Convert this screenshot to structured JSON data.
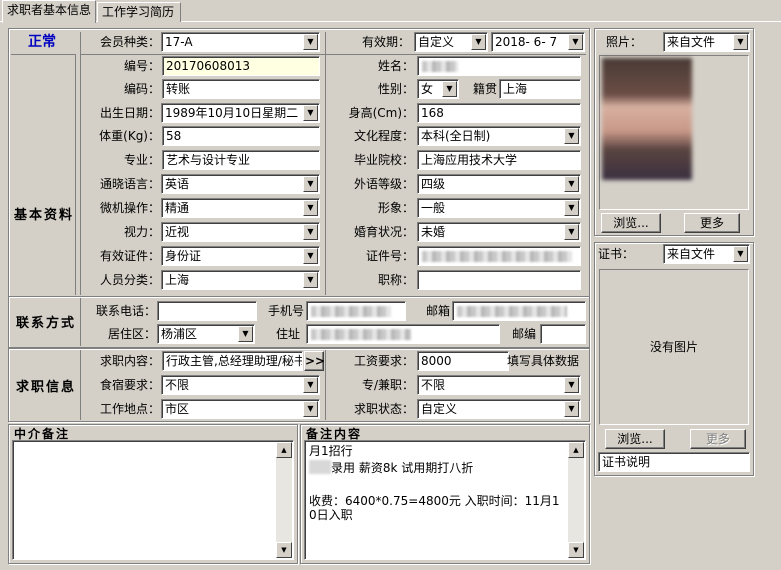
{
  "tabs": [
    "求职者基本信息",
    "工作学习简历"
  ],
  "status": "正常",
  "member_type": {
    "label": "会员种类：",
    "value": "17-A"
  },
  "validity": {
    "label": "有效期：",
    "mode": "自定义",
    "date": "2018- 6- 7"
  },
  "photo": {
    "label": "照片：",
    "source": "来自文件",
    "browse": "浏览...",
    "more": "更多"
  },
  "sections": {
    "basic": "基本资料",
    "contact": "联系方式",
    "job": "求职信息",
    "agency_note": "中介备注",
    "note_content": "备注内容"
  },
  "basic": {
    "id_label": "编号：",
    "id_value": "20170608013",
    "name_label": "姓名：",
    "code_label": "编码：",
    "code_value": "转账",
    "gender_label": "性别：",
    "gender_value": "女",
    "origin_label": "籍贯",
    "origin_value": "上海",
    "birth_label": "出生日期：",
    "birth_value": "1989年10月10日星期二",
    "height_label": "身高(Cm)：",
    "height_value": "168",
    "weight_label": "体重(Kg)：",
    "weight_value": "58",
    "edu_label": "文化程度：",
    "edu_value": "本科(全日制)",
    "major_label": "专业：",
    "major_value": "艺术与设计专业",
    "school_label": "毕业院校：",
    "school_value": "上海应用技术大学",
    "lang_label": "通晓语言：",
    "lang_value": "英语",
    "lang_level_label": "外语等级：",
    "lang_level_value": "四级",
    "pc_label": "微机操作：",
    "pc_value": "精通",
    "image_label": "形象：",
    "image_value": "一般",
    "vision_label": "视力：",
    "vision_value": "近视",
    "marriage_label": "婚育状况：",
    "marriage_value": "未婚",
    "cert_label": "有效证件：",
    "cert_value": "身份证",
    "cert_no_label": "证件号：",
    "category_label": "人员分类：",
    "category_value": "上海",
    "title_label": "职称："
  },
  "contact": {
    "phone_label": "联系电话：",
    "mobile_label": "手机号",
    "email_label": "邮箱",
    "district_label": "居住区：",
    "district_value": "杨浦区",
    "address_label": "住址",
    "zip_label": "邮编"
  },
  "job": {
    "content_label": "求职内容：",
    "content_value": "行政主管,总经理助理/秘书",
    "more_btn": ">>",
    "salary_label": "工资要求：",
    "salary_value": "8000",
    "salary_hint": "填写具体数据",
    "lodging_label": "食宿要求：",
    "lodging_value": "不限",
    "type_label": "专/兼职：",
    "type_value": "不限",
    "location_label": "工作地点：",
    "location_value": "市区",
    "state_label": "求职状态：",
    "state_value": "自定义"
  },
  "certificate": {
    "label": "证书：",
    "source": "来自文件",
    "no_image": "没有图片",
    "browse": "浏览...",
    "more": "更多",
    "desc": "证书说明"
  },
  "note_lines": [
    "月1招行",
    "录用 薪资8k 试用期打八折",
    "",
    "收费：6400*0.75=4800元 入职时间：11月10日入职"
  ]
}
